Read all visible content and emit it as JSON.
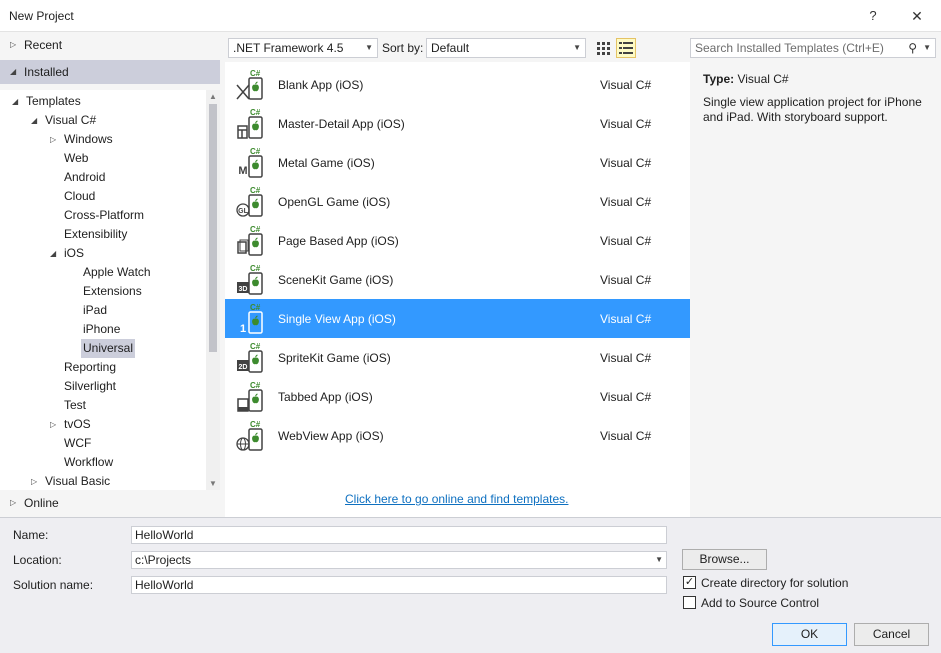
{
  "window": {
    "title": "New Project",
    "help_glyph": "?",
    "close_glyph": "✕"
  },
  "nav": {
    "recent": "Recent",
    "installed": "Installed",
    "online": "Online"
  },
  "tree": [
    {
      "label": "Templates",
      "depth": 0,
      "expander": "expanded"
    },
    {
      "label": "Visual C#",
      "depth": 1,
      "expander": "expanded"
    },
    {
      "label": "Windows",
      "depth": 2,
      "expander": "collapsed"
    },
    {
      "label": "Web",
      "depth": 2,
      "expander": "none"
    },
    {
      "label": "Android",
      "depth": 2,
      "expander": "none"
    },
    {
      "label": "Cloud",
      "depth": 2,
      "expander": "none"
    },
    {
      "label": "Cross-Platform",
      "depth": 2,
      "expander": "none"
    },
    {
      "label": "Extensibility",
      "depth": 2,
      "expander": "none"
    },
    {
      "label": "iOS",
      "depth": 2,
      "expander": "expanded"
    },
    {
      "label": "Apple Watch",
      "depth": 3,
      "expander": "none"
    },
    {
      "label": "Extensions",
      "depth": 3,
      "expander": "none"
    },
    {
      "label": "iPad",
      "depth": 3,
      "expander": "none"
    },
    {
      "label": "iPhone",
      "depth": 3,
      "expander": "none"
    },
    {
      "label": "Universal",
      "depth": 3,
      "expander": "none",
      "selected": true
    },
    {
      "label": "Reporting",
      "depth": 2,
      "expander": "none"
    },
    {
      "label": "Silverlight",
      "depth": 2,
      "expander": "none"
    },
    {
      "label": "Test",
      "depth": 2,
      "expander": "none"
    },
    {
      "label": "tvOS",
      "depth": 2,
      "expander": "collapsed"
    },
    {
      "label": "WCF",
      "depth": 2,
      "expander": "none"
    },
    {
      "label": "Workflow",
      "depth": 2,
      "expander": "none"
    },
    {
      "label": "Visual Basic",
      "depth": 1,
      "expander": "collapsed"
    }
  ],
  "toolbar": {
    "framework": ".NET Framework 4.5",
    "sort_label": "Sort by:",
    "sort_value": "Default",
    "search_placeholder": "Search Installed Templates (Ctrl+E)"
  },
  "templates": [
    {
      "name": "Blank App (iOS)",
      "lang": "Visual C#",
      "icon": "blank-app-icon",
      "badge": ""
    },
    {
      "name": "Master-Detail App (iOS)",
      "lang": "Visual C#",
      "icon": "master-detail-icon",
      "badge": ""
    },
    {
      "name": "Metal Game (iOS)",
      "lang": "Visual C#",
      "icon": "metal-game-icon",
      "badge": "M"
    },
    {
      "name": "OpenGL Game (iOS)",
      "lang": "Visual C#",
      "icon": "opengl-game-icon",
      "badge": "GL"
    },
    {
      "name": "Page Based App (iOS)",
      "lang": "Visual C#",
      "icon": "page-based-icon",
      "badge": ""
    },
    {
      "name": "SceneKit Game (iOS)",
      "lang": "Visual C#",
      "icon": "scenekit-icon",
      "badge": "3D"
    },
    {
      "name": "Single View App (iOS)",
      "lang": "Visual C#",
      "icon": "single-view-icon",
      "badge": "1",
      "selected": true
    },
    {
      "name": "SpriteKit Game (iOS)",
      "lang": "Visual C#",
      "icon": "spritekit-icon",
      "badge": "2D"
    },
    {
      "name": "Tabbed App (iOS)",
      "lang": "Visual C#",
      "icon": "tabbed-app-icon",
      "badge": ""
    },
    {
      "name": "WebView App (iOS)",
      "lang": "Visual C#",
      "icon": "webview-icon",
      "badge": ""
    }
  ],
  "icon_badge": "C#",
  "online_link": "Click here to go online and find templates.",
  "description": {
    "type_label": "Type:",
    "type_value": "Visual C#",
    "text": "Single view application project for iPhone and iPad. With storyboard support."
  },
  "form": {
    "name_label": "Name:",
    "name_value": "HelloWorld",
    "location_label": "Location:",
    "location_value": "c:\\Projects",
    "solution_label": "Solution name:",
    "solution_value": "HelloWorld",
    "browse": "Browse...",
    "create_dir": "Create directory for solution",
    "create_dir_checked": true,
    "check_glyph": "✓",
    "source_control": "Add to Source Control",
    "source_control_checked": false,
    "ok": "OK",
    "cancel": "Cancel"
  },
  "colors": {
    "selection": "#3399ff",
    "tree_selection": "#cccedb",
    "link": "#0e70c0",
    "csharp_green": "#3d8b2e"
  }
}
